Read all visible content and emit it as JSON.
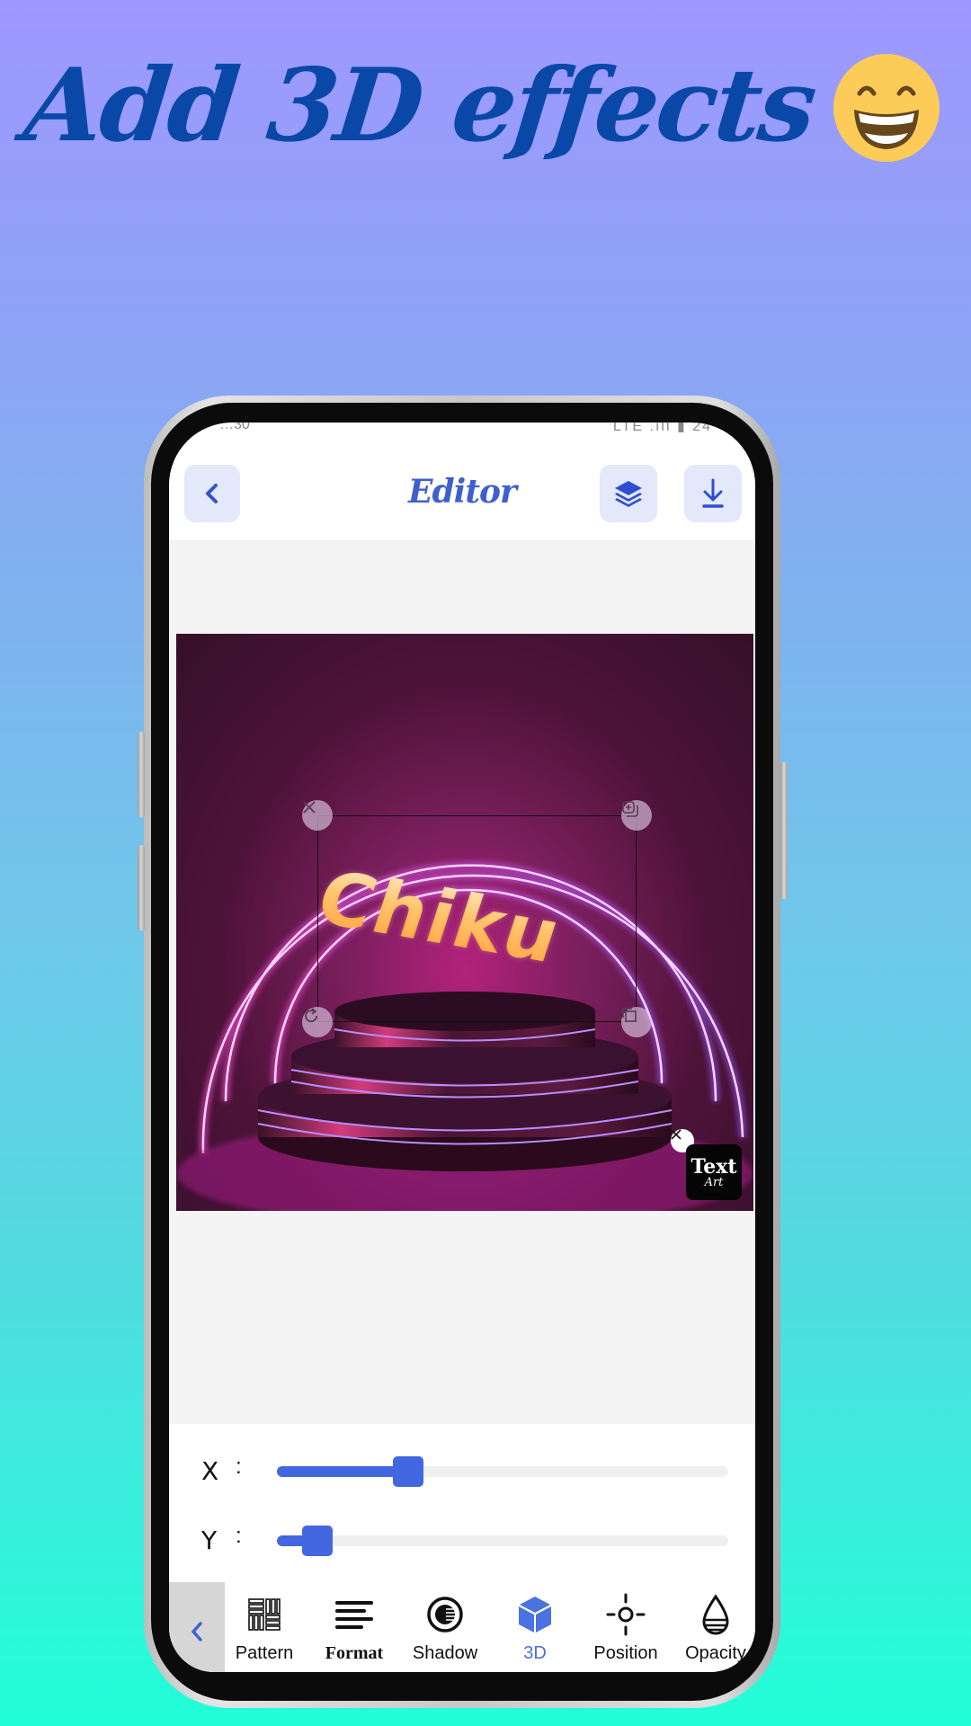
{
  "headline": {
    "text": "Add 3D effects",
    "emoji": "grinning-face-with-smiling-eyes"
  },
  "status_bar": {
    "time": "…30",
    "right": "LTE  .ıll ▮ 24"
  },
  "header": {
    "title": "Editor",
    "back_icon": "chevron-left-icon",
    "layers_icon": "layers-icon",
    "download_icon": "download-icon"
  },
  "canvas": {
    "text_layer": {
      "text": "Chiku"
    },
    "handles": [
      "delete",
      "duplicate",
      "rotate",
      "resize"
    ],
    "watermark": {
      "title": "Text",
      "subtitle": "Art"
    }
  },
  "sliders": [
    {
      "label": "X",
      "separator": ":",
      "value": 0.29
    },
    {
      "label": "Y",
      "separator": ":",
      "value": 0.09
    }
  ],
  "toolbar": {
    "back_icon": "chevron-left-icon",
    "items": [
      {
        "label": "Pattern",
        "icon": "pattern-icon",
        "active": false
      },
      {
        "label": "Format",
        "icon": "align-left-icon",
        "active": false
      },
      {
        "label": "Shadow",
        "icon": "shadow-icon",
        "active": false
      },
      {
        "label": "3D",
        "icon": "cube-icon",
        "active": true
      },
      {
        "label": "Position",
        "icon": "crosshair-icon",
        "active": false
      },
      {
        "label": "Opacity",
        "icon": "opacity-drop-icon",
        "active": false
      }
    ]
  },
  "colors": {
    "accent": "#4267e0",
    "headline": "#0a48a8",
    "title": "#3f5fcf",
    "button_bg": "#e3e8fb"
  }
}
